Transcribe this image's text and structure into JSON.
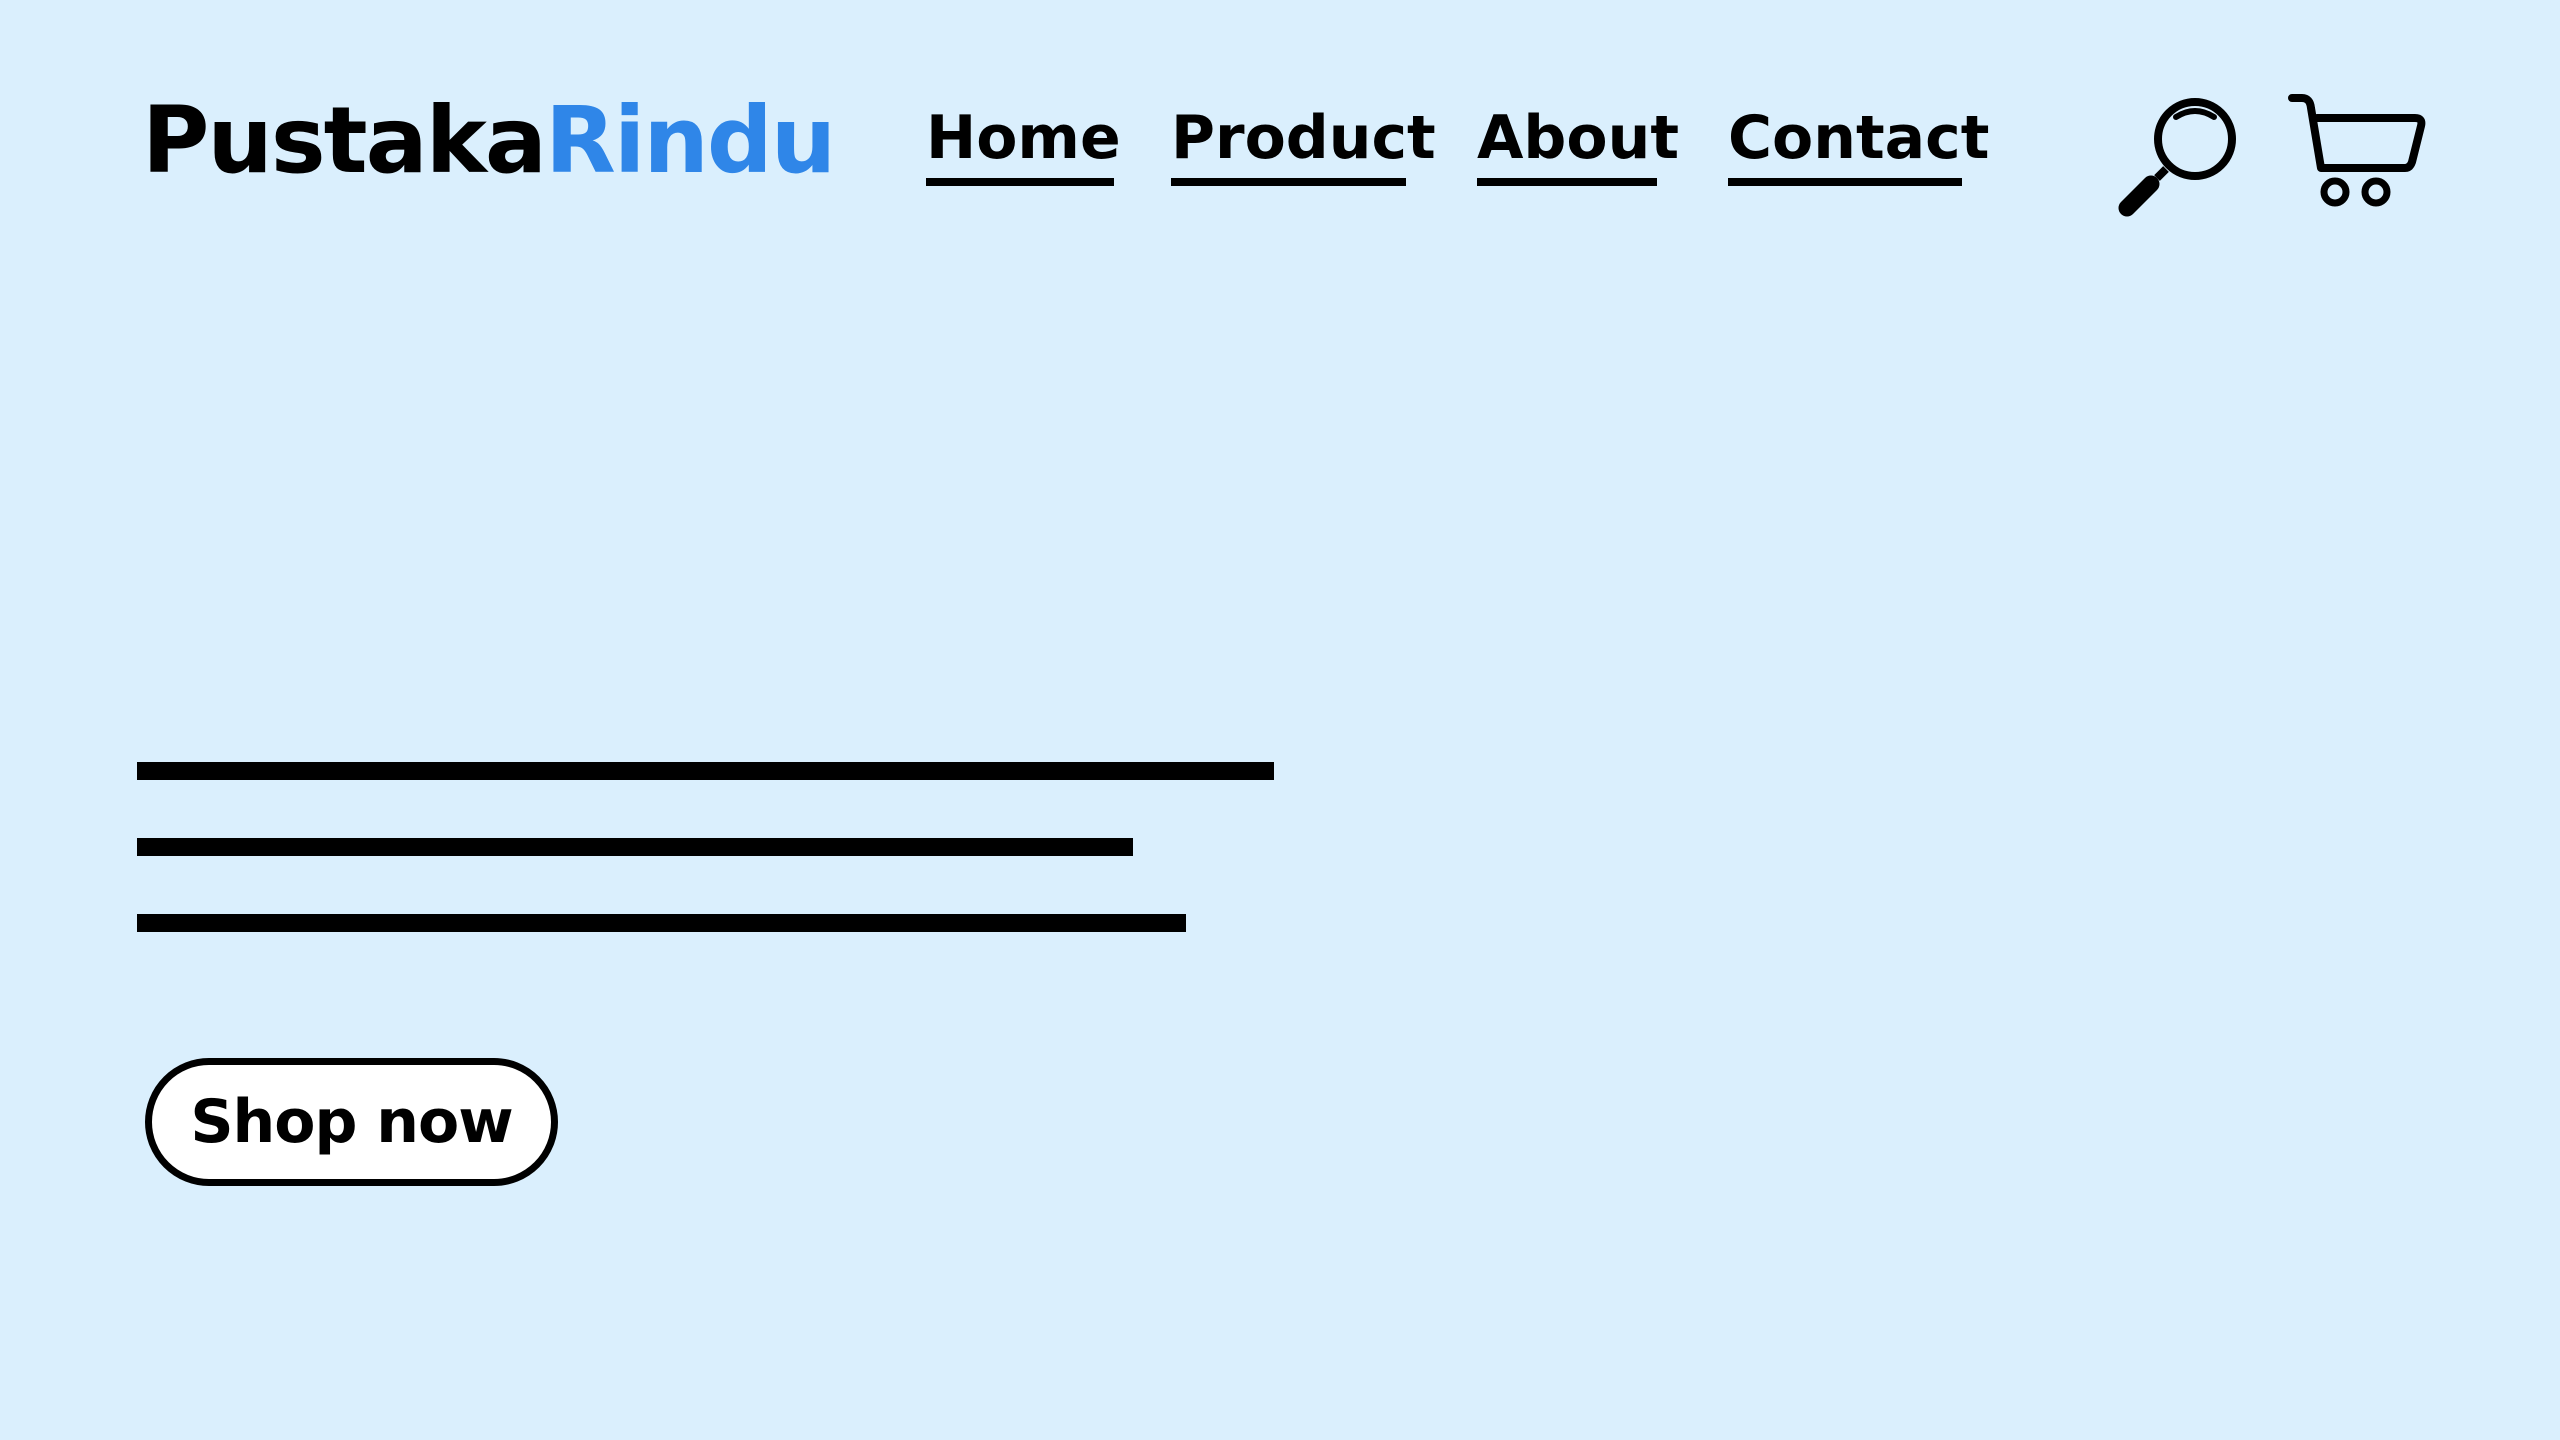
{
  "brand": {
    "name_primary": "Pustaka",
    "name_accent": "Rindu",
    "accent_color": "#2f86e8"
  },
  "nav": {
    "items": [
      {
        "label": "Home"
      },
      {
        "label": "Product"
      },
      {
        "label": "About"
      },
      {
        "label": "Contact"
      }
    ]
  },
  "header_icons": {
    "search": "search-icon",
    "cart": "cart-icon"
  },
  "hero": {
    "cta_label": "Shop now"
  },
  "colors": {
    "background": "#daeffd",
    "text": "#000000",
    "button_fill": "#ffffff"
  }
}
